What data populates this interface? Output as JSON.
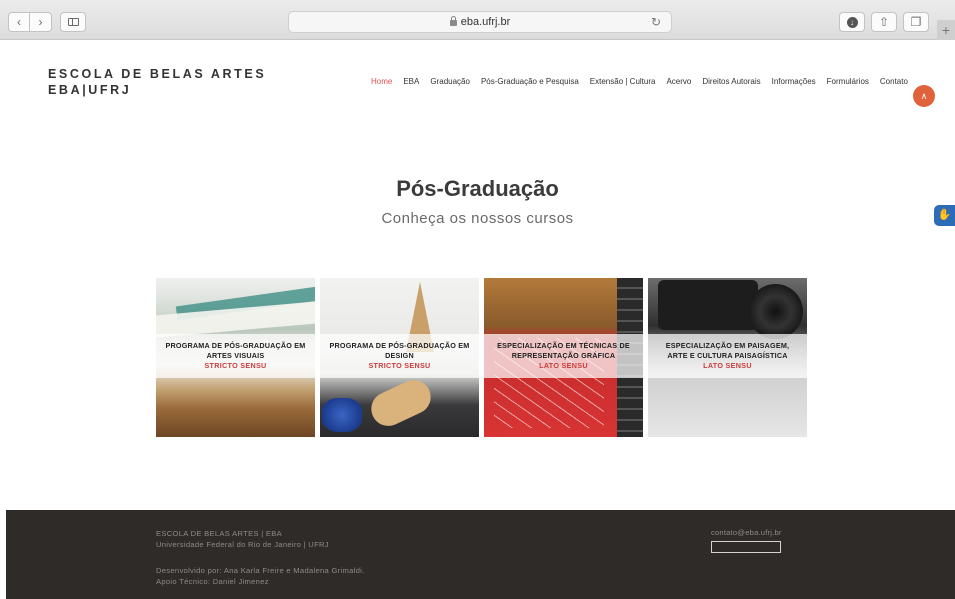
{
  "browser": {
    "url": "eba.ufrj.br"
  },
  "site": {
    "brand_line1": "ESCOLA DE BELAS ARTES",
    "brand_line2": "EBA|UFRJ",
    "nav": [
      "Home",
      "EBA",
      "Graduação",
      "Pós-Graduação e Pesquisa",
      "Extensão | Cultura",
      "Acervo",
      "Direitos Autorais",
      "Informações",
      "Formulários",
      "Contato"
    ],
    "active_nav": "Home"
  },
  "main": {
    "title": "Pós-Graduação",
    "subtitle": "Conheça os nossos cursos",
    "cards": [
      {
        "title_line1": "PROGRAMA DE PÓS-GRADUAÇÃO EM",
        "title_line2": "ARTES VISUAIS",
        "tag": "STRICTO SENSU"
      },
      {
        "title_line1": "PROGRAMA DE PÓS-GRADUAÇÃO EM",
        "title_line2": "DESIGN",
        "tag": "STRICTO SENSU"
      },
      {
        "title_line1": "ESPECIALIZAÇÃO EM TÉCNICAS DE",
        "title_line2": "REPRESENTAÇÃO GRÁFICA",
        "tag": "LATO SENSU"
      },
      {
        "title_line1": "ESPECIALIZAÇÃO EM PAISAGEM,",
        "title_line2": "ARTE E CULTURA PAISAGÍSTICA",
        "tag": "LATO SENSU"
      }
    ]
  },
  "footer": {
    "line1": "ESCOLA DE BELAS ARTES | EBA",
    "line2": "Universidade Federal do Rio de Janeiro | UFRJ",
    "credits1": "Desenvolvido por: Ana Karla Freire e Madalena Grimaldi.",
    "credits2": "Apoio Técnico: Daniel Jimenez",
    "email": "contato@eba.ufrj.br"
  },
  "colors": {
    "accent": "#d9534f",
    "footer_bg": "#2f2b28",
    "scroll_top": "#e0623a"
  }
}
